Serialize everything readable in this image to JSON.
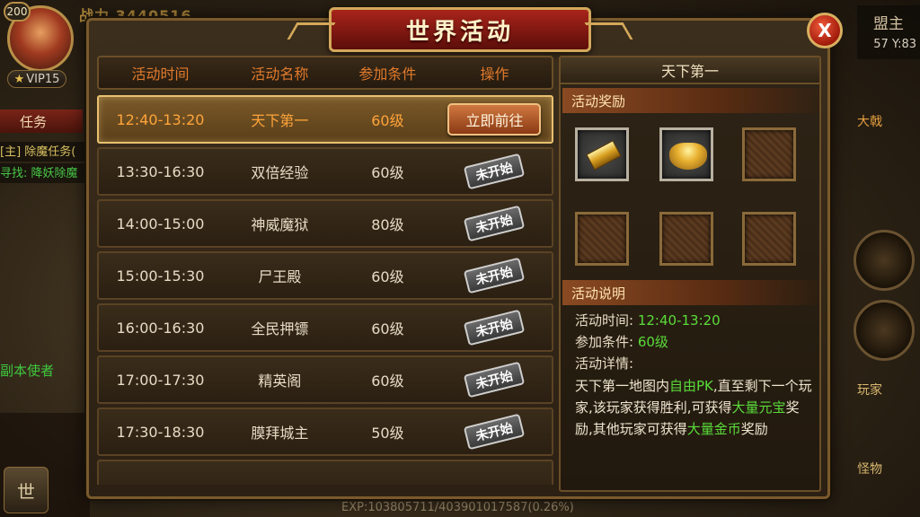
{
  "hud": {
    "level": "200",
    "vip": "VIP15",
    "combat_power": "战力 3440516",
    "task_tab": "任务",
    "task_line1": "[主] 除魔任务(",
    "task_line2": "寻找: 降妖除魔",
    "task_line3": "副本使者",
    "mic_label": "世",
    "ally_label": "盟主",
    "coords": "57 Y:83",
    "right_label1": "大戟",
    "right_label2": "玩家",
    "right_label3": "怪物",
    "exp": "EXP:103805711/403901017587(0.26%)"
  },
  "panel": {
    "title": "世界活动",
    "close_label": "X"
  },
  "table": {
    "headers": [
      "活动时间",
      "活动名称",
      "参加条件",
      "操作"
    ],
    "go_label": "立即前往",
    "not_started_label": "未开始",
    "rows": [
      {
        "time": "12:40-13:20",
        "name": "天下第一",
        "cond": "60级"
      },
      {
        "time": "13:30-16:30",
        "name": "双倍经验",
        "cond": "60级"
      },
      {
        "time": "14:00-15:00",
        "name": "神威魔狱",
        "cond": "80级"
      },
      {
        "time": "15:00-15:30",
        "name": "尸王殿",
        "cond": "60级"
      },
      {
        "time": "16:00-16:30",
        "name": "全民押镖",
        "cond": "60级"
      },
      {
        "time": "17:00-17:30",
        "name": "精英阁",
        "cond": "60级"
      },
      {
        "time": "17:30-18:30",
        "name": "膜拜城主",
        "cond": "50级"
      }
    ]
  },
  "side": {
    "title": "天下第一",
    "reward_head": "活动奖励",
    "desc_head": "活动说明",
    "time_label": "活动时间:",
    "time_value": "12:40-13:20",
    "cond_label": "参加条件:",
    "cond_value": "60级",
    "detail_label": "活动详情:",
    "detail": {
      "p1": "天下第一地图内",
      "h1": "自由PK",
      "p2": ",直至剩下一个玩家,该玩家获得胜利,可获得",
      "h2": "大量元宝",
      "p3": "奖励,其他玩家可获得",
      "h3": "大量金币",
      "p4": "奖励"
    }
  }
}
